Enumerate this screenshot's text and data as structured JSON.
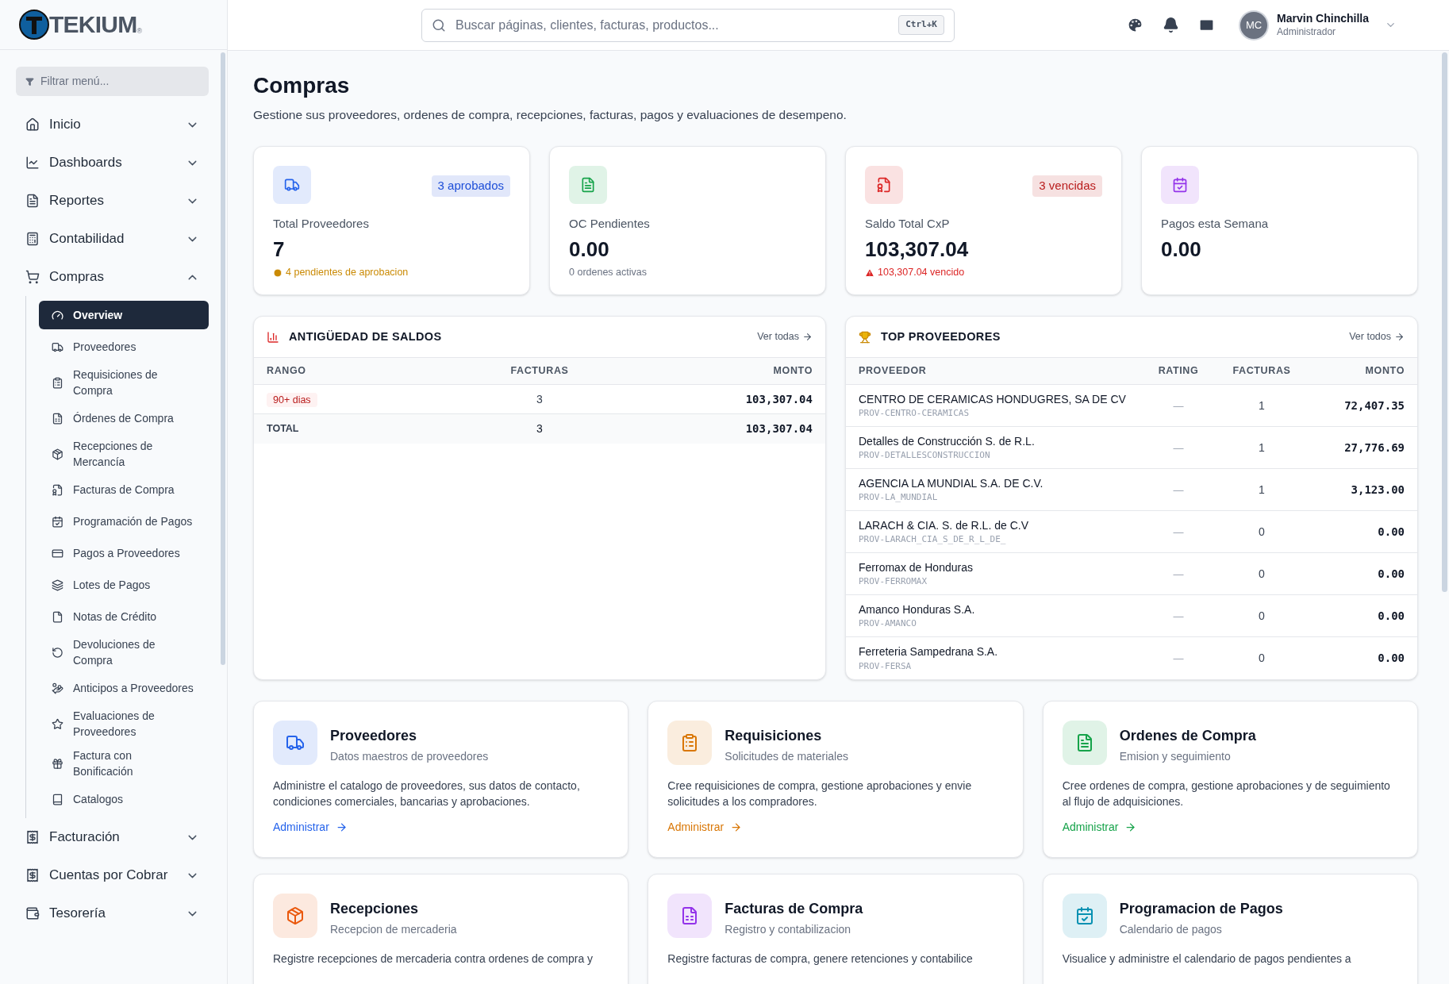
{
  "logo": {
    "text": "TEKIUM",
    "mark": "®"
  },
  "sidebar": {
    "filter_placeholder": "Filtrar menú...",
    "items": [
      {
        "label": "Inicio",
        "expanded": false
      },
      {
        "label": "Dashboards",
        "expanded": false
      },
      {
        "label": "Reportes",
        "expanded": false
      },
      {
        "label": "Contabilidad",
        "expanded": false
      },
      {
        "label": "Compras",
        "expanded": true,
        "children": [
          {
            "label": "Overview",
            "selected": true
          },
          {
            "label": "Proveedores",
            "selected": false
          },
          {
            "label": "Requisiciones de Compra",
            "selected": false
          },
          {
            "label": "Órdenes de Compra",
            "selected": false
          },
          {
            "label": "Recepciones de Mercancía",
            "selected": false
          },
          {
            "label": "Facturas de Compra",
            "selected": false
          },
          {
            "label": "Programación de Pagos",
            "selected": false
          },
          {
            "label": "Pagos a Proveedores",
            "selected": false
          },
          {
            "label": "Lotes de Pagos",
            "selected": false
          },
          {
            "label": "Notas de Crédito",
            "selected": false
          },
          {
            "label": "Devoluciones de Compra",
            "selected": false
          },
          {
            "label": "Anticipos a Proveedores",
            "selected": false
          },
          {
            "label": "Evaluaciones de Proveedores",
            "selected": false
          },
          {
            "label": "Factura con Bonificación",
            "selected": false
          },
          {
            "label": "Catalogos",
            "selected": false
          }
        ]
      },
      {
        "label": "Facturación",
        "expanded": false
      },
      {
        "label": "Cuentas por Cobrar",
        "expanded": false
      },
      {
        "label": "Tesorería",
        "expanded": false
      }
    ]
  },
  "topbar": {
    "search_placeholder": "Buscar páginas, clientes, facturas, productos...",
    "shortcut": "Ctrl+K",
    "user": {
      "initials": "MC",
      "name": "Marvin Chinchilla",
      "role": "Administrador"
    }
  },
  "page": {
    "title": "Compras",
    "subtitle": "Gestione sus proveedores, ordenes de compra, recepciones, facturas, pagos y evaluaciones de desempeno."
  },
  "stats": [
    {
      "label": "Total Proveedores",
      "value": "7",
      "color": "#2563eb",
      "badge": {
        "text": "3 aprobados",
        "color": "#1d4ed8"
      },
      "note": {
        "text": "4 pendientes de aprobacion",
        "kind": "pending"
      }
    },
    {
      "label": "OC Pendientes",
      "value": "0.00",
      "color": "#16a34a",
      "note": {
        "text": "0 ordenes activas",
        "kind": "plain"
      }
    },
    {
      "label": "Saldo Total CxP",
      "value": "103,307.04",
      "color": "#dc2626",
      "badge": {
        "text": "3 vencidas",
        "color": "#b91c1c"
      },
      "note": {
        "text": "103,307.04 vencido",
        "kind": "alert"
      }
    },
    {
      "label": "Pagos esta Semana",
      "value": "0.00",
      "color": "#9333ea"
    }
  ],
  "aging": {
    "title": "ANTIGÜEDAD DE SALDOS",
    "link": "Ver todas",
    "columns": [
      "RANGO",
      "FACTURAS",
      "MONTO"
    ],
    "rows": [
      {
        "range": "90+ dias",
        "facturas": "3",
        "monto": "103,307.04"
      }
    ],
    "total": {
      "label": "TOTAL",
      "facturas": "3",
      "monto": "103,307.04"
    }
  },
  "top": {
    "title": "TOP PROVEEDORES",
    "link": "Ver todos",
    "columns": [
      "PROVEEDOR",
      "RATING",
      "FACTURAS",
      "MONTO"
    ],
    "rows": [
      {
        "name": "CENTRO DE CERAMICAS HONDUGRES, SA DE CV",
        "code": "PROV-CENTRO-CERAMICAS",
        "rating": "—",
        "facturas": "1",
        "monto": "72,407.35"
      },
      {
        "name": "Detalles de Construcción S. de R.L.",
        "code": "PROV-DETALLESCONSTRUCCION",
        "rating": "—",
        "facturas": "1",
        "monto": "27,776.69"
      },
      {
        "name": "AGENCIA LA MUNDIAL S.A. DE C.V.",
        "code": "PROV-LA_MUNDIAL",
        "rating": "—",
        "facturas": "1",
        "monto": "3,123.00"
      },
      {
        "name": "LARACH & CIA. S. de R.L. de C.V",
        "code": "PROV-LARACH_CIA_S_DE_R_L_DE_",
        "rating": "—",
        "facturas": "0",
        "monto": "0.00"
      },
      {
        "name": "Ferromax de Honduras",
        "code": "PROV-FERROMAX",
        "rating": "—",
        "facturas": "0",
        "monto": "0.00"
      },
      {
        "name": "Amanco Honduras S.A.",
        "code": "PROV-AMANCO",
        "rating": "—",
        "facturas": "0",
        "monto": "0.00"
      },
      {
        "name": "Ferreteria Sampedrana S.A.",
        "code": "PROV-FERSA",
        "rating": "—",
        "facturas": "0",
        "monto": "0.00"
      }
    ]
  },
  "modules": [
    {
      "title": "Proveedores",
      "subtitle": "Datos maestros de proveedores",
      "description": "Administre el catalogo de proveedores, sus datos de contacto, condiciones comerciales, bancarias y aprobaciones.",
      "link": "Administrar",
      "color": "#2563eb"
    },
    {
      "title": "Requisiciones",
      "subtitle": "Solicitudes de materiales",
      "description": "Cree requisiciones de compra, gestione aprobaciones y envie solicitudes a los compradores.",
      "link": "Administrar",
      "color": "#d97706"
    },
    {
      "title": "Ordenes de Compra",
      "subtitle": "Emision y seguimiento",
      "description": "Cree ordenes de compra, gestione aprobaciones y de seguimiento al flujo de adquisiciones.",
      "link": "Administrar",
      "color": "#16a34a"
    },
    {
      "title": "Recepciones",
      "subtitle": "Recepcion de mercaderia",
      "description": "Registre recepciones de mercaderia contra ordenes de compra y",
      "color": "#ea580c"
    },
    {
      "title": "Facturas de Compra",
      "subtitle": "Registro y contabilizacion",
      "description": "Registre facturas de compra, genere retenciones y contabilice",
      "color": "#9333ea"
    },
    {
      "title": "Programacion de Pagos",
      "subtitle": "Calendario de pagos",
      "description": "Visualice y administre el calendario de pagos pendientes a",
      "color": "#0891b2"
    }
  ]
}
